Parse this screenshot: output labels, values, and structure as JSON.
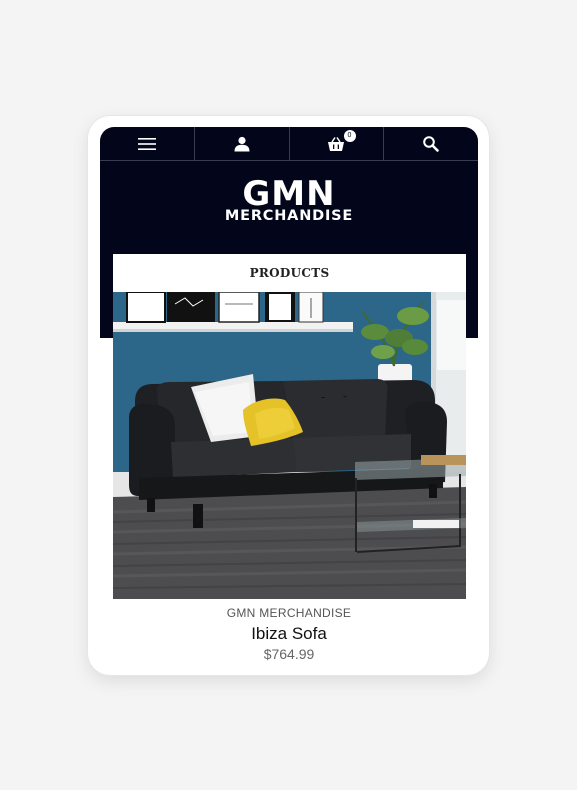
{
  "nav": {
    "icons": [
      "menu-icon",
      "user-icon",
      "cart-icon",
      "search-icon"
    ],
    "cart_count": "0"
  },
  "logo": {
    "line1": "GMN",
    "line2": "MERCHANDISE"
  },
  "section": {
    "title": "PRODUCTS"
  },
  "product": {
    "brand": "GMN MERCHANDISE",
    "name": "Ibiza Sofa",
    "price": "$764.99"
  },
  "colors": {
    "header_bg": "#03061a",
    "accent_pillow": "#e6c229",
    "wall": "#2f6a8c"
  }
}
